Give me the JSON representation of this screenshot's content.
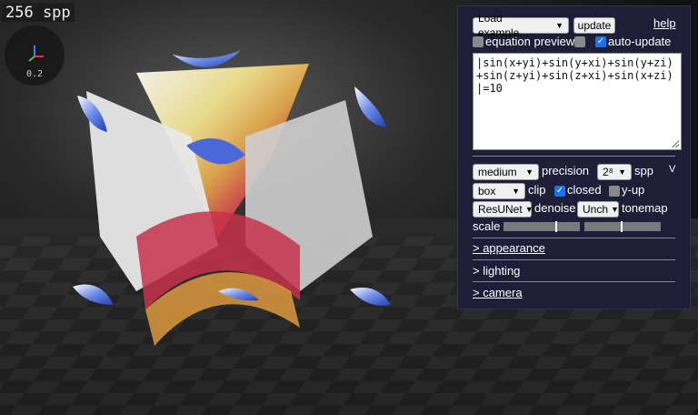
{
  "viewport": {
    "spp_label": "256 spp",
    "axes_scale": "0.2"
  },
  "panel": {
    "load_example": "Load example...",
    "update": "update",
    "help": "help",
    "equation_preview": {
      "label": "equation preview",
      "checked": false
    },
    "auto_update": {
      "label": "auto-update",
      "checked": true
    },
    "equation": "|sin(x+yi)+sin(y+xi)+sin(y+zi)+sin(z+yi)+sin(z+xi)+sin(x+zi)|=10",
    "precision_value": "medium",
    "precision_label": "precision",
    "spp_value": "2⁸",
    "spp_label": "spp",
    "v_label": "V",
    "clip_value": "box",
    "clip_label": "clip",
    "closed": {
      "label": "closed",
      "checked": true
    },
    "y_up": {
      "label": "y-up",
      "checked": false
    },
    "denoise_value": "ResUNet",
    "denoise_label": "denoise",
    "tonemap_value": "Unch",
    "tonemap_label": "tonemap",
    "scale_label": "scale",
    "sections": [
      "> appearance",
      "> lighting",
      "> camera"
    ]
  },
  "colors": {
    "panel_bg": "#1e1e38",
    "checkbox_on": "#1a73e8",
    "checkbox_off": "#8a8a8a"
  }
}
